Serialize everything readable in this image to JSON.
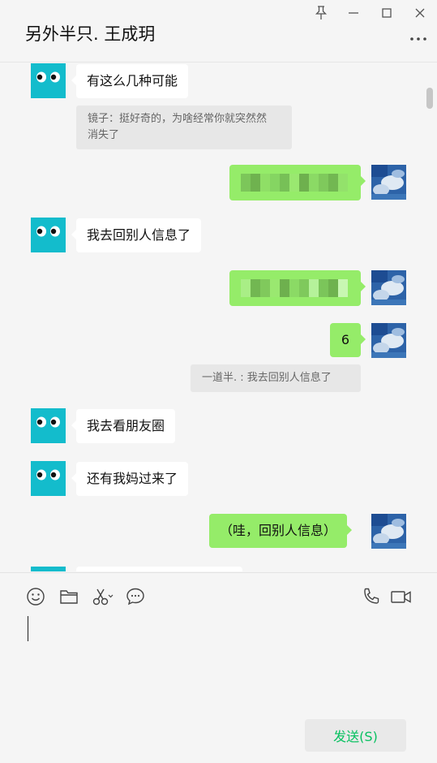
{
  "window": {
    "title": "另外半只. 王成玥",
    "buttons": [
      "pin",
      "minimize",
      "maximize",
      "close"
    ]
  },
  "messages": [
    {
      "side": "in",
      "text": "有这么几种可能"
    },
    {
      "side": "quote",
      "text": "镜子：挺好奇的，为啥经常你就突然消失了"
    },
    {
      "side": "out",
      "content": "pixelated-image"
    },
    {
      "side": "in",
      "text": "我去回别人信息了"
    },
    {
      "side": "out",
      "content": "pixelated-image"
    },
    {
      "side": "out",
      "text": "6"
    },
    {
      "side": "quote",
      "text": "一道半. : 我去回别人信息了"
    },
    {
      "side": "in",
      "text": "我去看朋友圈"
    },
    {
      "side": "in",
      "text": "还有我妈过来了"
    },
    {
      "side": "out",
      "text": "（哇，回别人信息）"
    }
  ],
  "quotes": {
    "q1_line1": "镜子：挺好奇的，为啥经常你就突然然",
    "q1_line2": "消失了"
  },
  "toolbar": {
    "icons": [
      "emoji-icon",
      "folder-icon",
      "scissors-icon",
      "chat-history-icon",
      "phone-icon",
      "video-icon"
    ]
  },
  "input": {
    "value": ""
  },
  "send_button": {
    "label": "发送(S)"
  },
  "colors": {
    "background": "#f5f5f5",
    "outgoing_bubble": "#95ec69",
    "incoming_bubble": "#ffffff",
    "quote_bg": "#e7e7e7",
    "send_text": "#07c160",
    "owl_avatar": "#13bccc"
  }
}
